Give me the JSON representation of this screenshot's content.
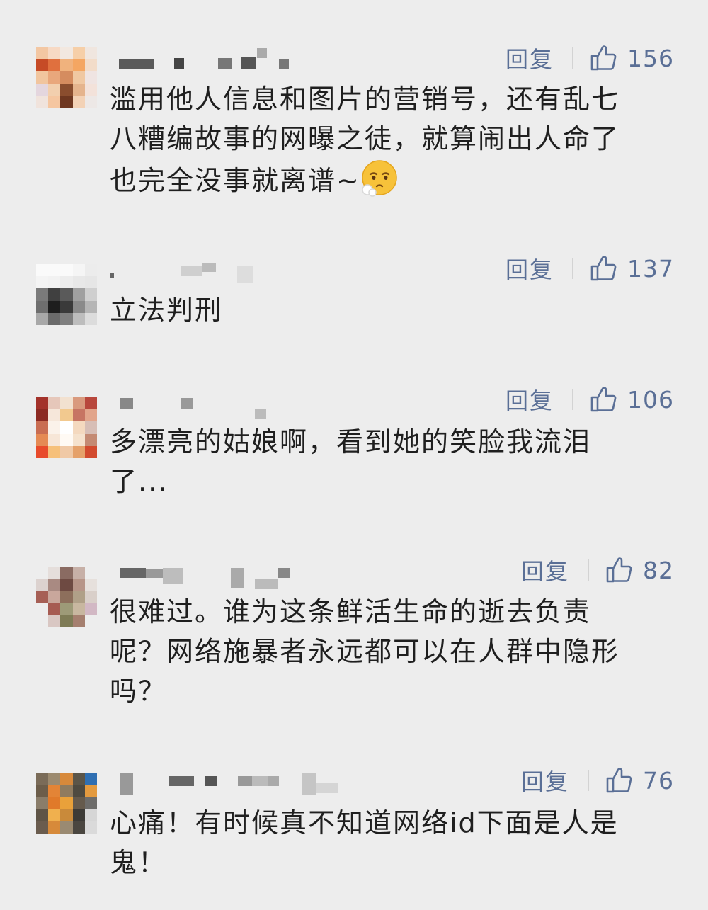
{
  "comments": [
    {
      "reply_label": "回复",
      "likes": "156",
      "text": "滥用他人信息和图片的营销号，还有乱七\n八糟编故事的网曝之徒，就算闹出人命了\n也完全没事就离谱~",
      "emoji": "pensive-face-emoji"
    },
    {
      "reply_label": "回复",
      "likes": "137",
      "text": "立法判刑"
    },
    {
      "reply_label": "回复",
      "likes": "106",
      "text": "多漂亮的姑娘啊，看到她的笑脸我流泪\n了..."
    },
    {
      "reply_label": "回复",
      "likes": "82",
      "text": "很难过。谁为这条鲜活生命的逝去负责\n呢？网络施暴者永远都可以在人群中隐形\n吗？"
    },
    {
      "reply_label": "回复",
      "likes": "76",
      "text": "心痛！有时候真不知道网络id下面是人是\n鬼！"
    }
  ],
  "icons": {
    "like": "thumbs-up-outline-icon",
    "avatar": "pixelated-avatar"
  },
  "colors": {
    "background": "#ededed",
    "action": "#5a6f96",
    "text": "#1f1f1f"
  }
}
